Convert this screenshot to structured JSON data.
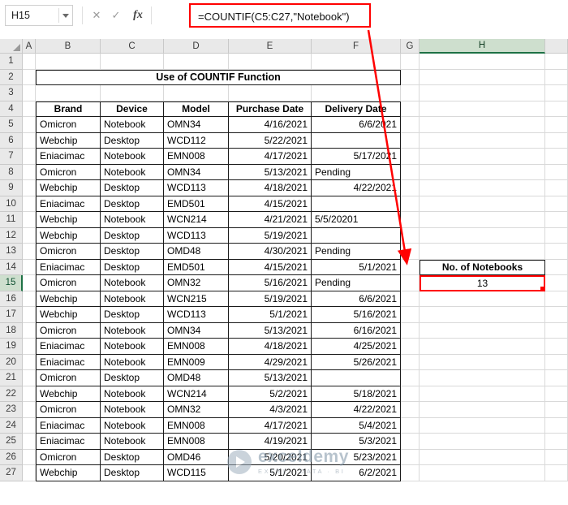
{
  "name_box": {
    "value": "H15"
  },
  "formula_bar": {
    "formula": "=COUNTIF(C5:C27,\"Notebook\")",
    "fx": "fx",
    "cancel": "✕",
    "enter": "✓"
  },
  "selection": {
    "cell": "H15",
    "column": "H",
    "row": 15
  },
  "columns": [
    "A",
    "B",
    "C",
    "D",
    "E",
    "F",
    "G",
    "H"
  ],
  "row_count": 27,
  "sheet": {
    "title": "Use of COUNTIF Function",
    "table": {
      "headers": [
        "Brand",
        "Device",
        "Model",
        "Purchase Date",
        "Delivery Date"
      ],
      "rows": [
        [
          "Omicron",
          "Notebook",
          "OMN34",
          "4/16/2021",
          "6/6/2021"
        ],
        [
          "Webchip",
          "Desktop",
          "WCD112",
          "5/22/2021",
          ""
        ],
        [
          "Eniacimac",
          "Notebook",
          "EMN008",
          "4/17/2021",
          "5/17/2021"
        ],
        [
          "Omicron",
          "Notebook",
          "OMN34",
          "5/13/2021",
          "Pending"
        ],
        [
          "Webchip",
          "Desktop",
          "WCD113",
          "4/18/2021",
          "4/22/2021"
        ],
        [
          "Eniacimac",
          "Desktop",
          "EMD501",
          "4/15/2021",
          ""
        ],
        [
          "Webchip",
          "Notebook",
          "WCN214",
          "4/21/2021",
          "5/5/20201"
        ],
        [
          "Webchip",
          "Desktop",
          "WCD113",
          "5/19/2021",
          ""
        ],
        [
          "Omicron",
          "Desktop",
          "OMD48",
          "4/30/2021",
          "Pending"
        ],
        [
          "Eniacimac",
          "Desktop",
          "EMD501",
          "4/15/2021",
          "5/1/2021"
        ],
        [
          "Omicron",
          "Notebook",
          "OMN32",
          "5/16/2021",
          "Pending"
        ],
        [
          "Webchip",
          "Notebook",
          "WCN215",
          "5/19/2021",
          "6/6/2021"
        ],
        [
          "Webchip",
          "Desktop",
          "WCD113",
          "5/1/2021",
          "5/16/2021"
        ],
        [
          "Omicron",
          "Notebook",
          "OMN34",
          "5/13/2021",
          "6/16/2021"
        ],
        [
          "Eniacimac",
          "Notebook",
          "EMN008",
          "4/18/2021",
          "4/25/2021"
        ],
        [
          "Eniacimac",
          "Notebook",
          "EMN009",
          "4/29/2021",
          "5/26/2021"
        ],
        [
          "Omicron",
          "Desktop",
          "OMD48",
          "5/13/2021",
          ""
        ],
        [
          "Webchip",
          "Notebook",
          "WCN214",
          "5/2/2021",
          "5/18/2021"
        ],
        [
          "Omicron",
          "Notebook",
          "OMN32",
          "4/3/2021",
          "4/22/2021"
        ],
        [
          "Eniacimac",
          "Notebook",
          "EMN008",
          "4/17/2021",
          "5/4/2021"
        ],
        [
          "Eniacimac",
          "Notebook",
          "EMN008",
          "4/19/2021",
          "5/3/2021"
        ],
        [
          "Omicron",
          "Desktop",
          "OMD46",
          "5/20/2021",
          "5/23/2021"
        ],
        [
          "Webchip",
          "Desktop",
          "WCD115",
          "5/1/2021",
          "6/2/2021"
        ]
      ]
    },
    "result": {
      "label": "No. of Notebooks",
      "value": "13"
    },
    "text_left_values": [
      "Pending",
      "5/5/20201"
    ]
  },
  "watermark": {
    "brand": "exceldemy",
    "tagline": "EXCEL · DATA · BI"
  },
  "colors": {
    "selection_green": "#1E7145",
    "selected_header_bg": "#CEDFCE",
    "annotation_red": "#FF0000",
    "gridline": "#D9D9D9"
  }
}
